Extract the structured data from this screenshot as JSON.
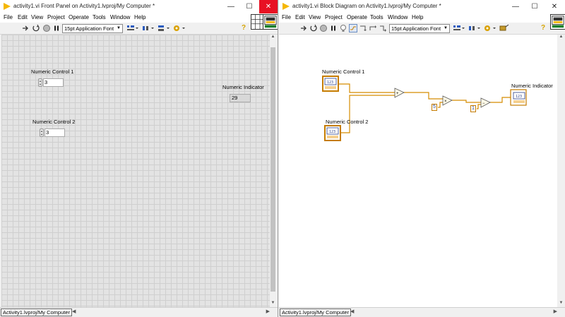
{
  "front_panel": {
    "title": "activity1.vi Front Panel on Activity1.lvproj/My Computer *",
    "menu": [
      "File",
      "Edit",
      "View",
      "Project",
      "Operate",
      "Tools",
      "Window",
      "Help"
    ],
    "font": "15pt Application Font",
    "controls": [
      {
        "label": "Numeric Control 1",
        "value": "3"
      },
      {
        "label": "Numeric Control 2",
        "value": "3"
      }
    ],
    "indicator": {
      "label": "Numeric Indicator",
      "value": "29"
    },
    "status_context": "Activity1.lvproj/My Computer"
  },
  "block_diagram": {
    "title": "activity1.vi Block Diagram on Activity1.lvproj/My Computer *",
    "menu": [
      "File",
      "Edit",
      "View",
      "Project",
      "Operate",
      "Tools",
      "Window",
      "Help"
    ],
    "font": "15pt Application Font",
    "terminals": [
      {
        "label": "Numeric Control 1",
        "type": "I32"
      },
      {
        "label": "Numeric Control 2",
        "type": "I32"
      },
      {
        "label": "Numeric Indicator",
        "type": "I32"
      }
    ],
    "constants": [
      "5",
      "1"
    ],
    "status_context": "Activity1.lvproj/My Computer"
  },
  "colors": {
    "wire": "#d58c00",
    "terminal_border": "#c57c00",
    "close_hover": "#e81123"
  }
}
